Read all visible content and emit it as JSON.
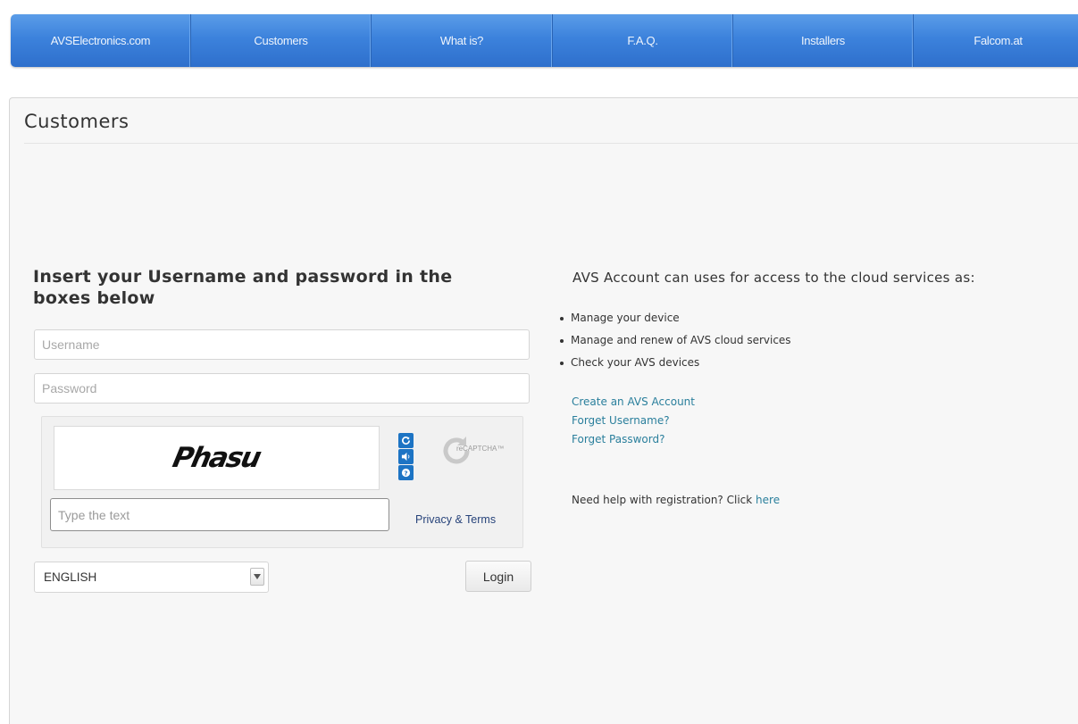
{
  "nav": {
    "items": [
      {
        "label": "AVSElectronics.com"
      },
      {
        "label": "Customers"
      },
      {
        "label": "What is?"
      },
      {
        "label": "F.A.Q."
      },
      {
        "label": "Installers"
      },
      {
        "label": "Falcom.at"
      }
    ]
  },
  "page": {
    "title": "Customers"
  },
  "login": {
    "heading": "Insert your Username and password in the boxes below",
    "username_placeholder": "Username",
    "username_value": "",
    "password_placeholder": "Password",
    "password_value": "",
    "captcha": {
      "challenge_text": "Phasu",
      "input_placeholder": "Type the text",
      "input_value": "",
      "privacy_label": "Privacy & Terms",
      "logo_text": "reCAPTCHA™",
      "refresh_icon": "refresh-icon",
      "audio_icon": "audio-icon",
      "help_icon": "help-icon"
    },
    "language": {
      "selected": "ENGLISH"
    },
    "login_label": "Login"
  },
  "info": {
    "heading": "AVS Account can uses for access to the cloud services as:",
    "bullets": [
      "Manage your device",
      "Manage and renew of AVS cloud services",
      "Check your AVS devices"
    ],
    "links": {
      "create": "Create an AVS Account",
      "forget_username": "Forget Username?",
      "forget_password": "Forget Password?"
    },
    "help_text": "Need help with registration? Click",
    "help_link": "here"
  },
  "colors": {
    "nav_blue": "#3c82dc",
    "link": "#2a7f9c",
    "captcha_button": "#1d74c4",
    "panel_bg": "#f7f7f7"
  }
}
